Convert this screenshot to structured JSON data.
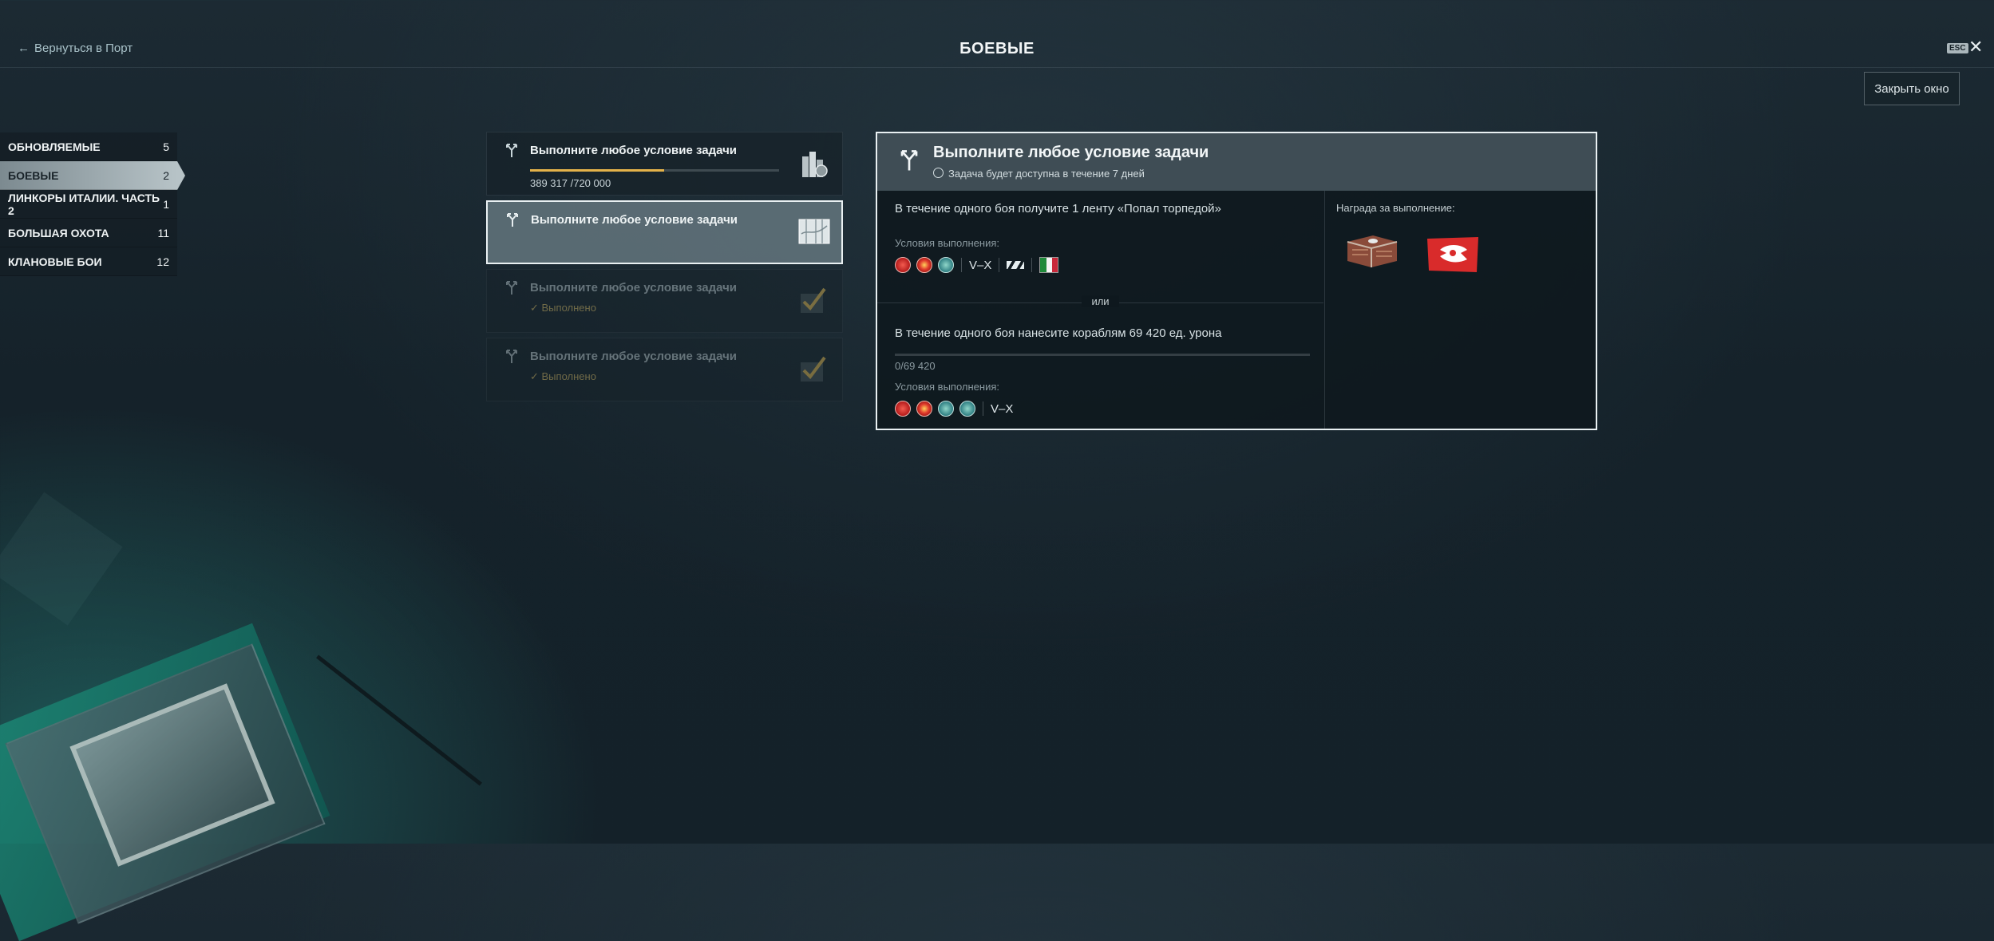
{
  "header": {
    "back_label": "Вернуться в Порт",
    "title": "БОЕВЫЕ",
    "esc_label": "ESC",
    "close_window_label": "Закрыть окно"
  },
  "sidebar": {
    "items": [
      {
        "label": "ОБНОВЛЯЕМЫЕ",
        "count": "5"
      },
      {
        "label": "БОЕВЫЕ",
        "count": "2"
      },
      {
        "label": "ЛИНКОРЫ ИТАЛИИ. ЧАСТЬ 2",
        "count": "1"
      },
      {
        "label": "БОЛЬШАЯ ОХОТА",
        "count": "11"
      },
      {
        "label": "КЛАНОВЫЕ БОИ",
        "count": "12"
      }
    ]
  },
  "tasks": [
    {
      "title": "Выполните любое условие задачи",
      "progress_text": "389 317 /720 000",
      "progress_fraction": 0.54,
      "state": "in-progress"
    },
    {
      "title": "Выполните любое условие задачи",
      "state": "selected"
    },
    {
      "title": "Выполните любое условие задачи",
      "status": "Выполнено",
      "state": "done"
    },
    {
      "title": "Выполните любое условие задачи",
      "status": "Выполнено",
      "state": "done"
    }
  ],
  "detail": {
    "title": "Выполните любое условие задачи",
    "subtitle": "Задача будет доступна в течение 7 дней",
    "condition1_text": "В течение одного боя получите 1 ленту «Попал торпедой»",
    "conditions_label": "Условия выполнения:",
    "tier_range": "V–X",
    "or_label": "или",
    "condition2_text": "В течение одного боя нанесите кораблям 69 420 ед. урона",
    "condition2_progress": "0/69 420",
    "reward_label": "Награда за выполнение:"
  }
}
